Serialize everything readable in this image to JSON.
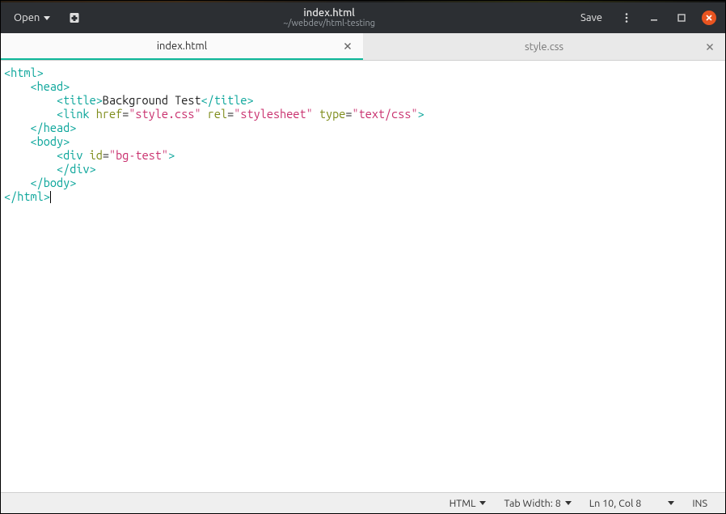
{
  "header": {
    "open_label": "Open",
    "save_label": "Save",
    "title": "index.html",
    "subtitle": "~/webdev/html-testing"
  },
  "tabs": [
    {
      "label": "index.html",
      "active": true
    },
    {
      "label": "style.css",
      "active": false
    }
  ],
  "editor": {
    "lines": [
      [
        {
          "cls": "tok-punct",
          "t": "<"
        },
        {
          "cls": "tok-tag",
          "t": "html"
        },
        {
          "cls": "tok-punct",
          "t": ">"
        }
      ],
      [
        {
          "cls": "tok-text",
          "t": "    "
        },
        {
          "cls": "tok-punct",
          "t": "<"
        },
        {
          "cls": "tok-tag",
          "t": "head"
        },
        {
          "cls": "tok-punct",
          "t": ">"
        }
      ],
      [
        {
          "cls": "tok-text",
          "t": "        "
        },
        {
          "cls": "tok-punct",
          "t": "<"
        },
        {
          "cls": "tok-tag",
          "t": "title"
        },
        {
          "cls": "tok-punct",
          "t": ">"
        },
        {
          "cls": "tok-text",
          "t": "Background Test"
        },
        {
          "cls": "tok-punct",
          "t": "</"
        },
        {
          "cls": "tok-tag",
          "t": "title"
        },
        {
          "cls": "tok-punct",
          "t": ">"
        }
      ],
      [
        {
          "cls": "tok-text",
          "t": "        "
        },
        {
          "cls": "tok-punct",
          "t": "<"
        },
        {
          "cls": "tok-tag",
          "t": "link"
        },
        {
          "cls": "tok-text",
          "t": " "
        },
        {
          "cls": "tok-attr",
          "t": "href"
        },
        {
          "cls": "tok-text",
          "t": "="
        },
        {
          "cls": "tok-str",
          "t": "\"style.css\""
        },
        {
          "cls": "tok-text",
          "t": " "
        },
        {
          "cls": "tok-attr",
          "t": "rel"
        },
        {
          "cls": "tok-text",
          "t": "="
        },
        {
          "cls": "tok-str",
          "t": "\"stylesheet\""
        },
        {
          "cls": "tok-text",
          "t": " "
        },
        {
          "cls": "tok-attr",
          "t": "type"
        },
        {
          "cls": "tok-text",
          "t": "="
        },
        {
          "cls": "tok-str",
          "t": "\"text/css\""
        },
        {
          "cls": "tok-punct",
          "t": ">"
        }
      ],
      [
        {
          "cls": "tok-text",
          "t": "    "
        },
        {
          "cls": "tok-punct",
          "t": "</"
        },
        {
          "cls": "tok-tag",
          "t": "head"
        },
        {
          "cls": "tok-punct",
          "t": ">"
        }
      ],
      [
        {
          "cls": "tok-text",
          "t": "    "
        },
        {
          "cls": "tok-punct",
          "t": "<"
        },
        {
          "cls": "tok-tag",
          "t": "body"
        },
        {
          "cls": "tok-punct",
          "t": ">"
        }
      ],
      [
        {
          "cls": "tok-text",
          "t": "        "
        },
        {
          "cls": "tok-punct",
          "t": "<"
        },
        {
          "cls": "tok-tag",
          "t": "div"
        },
        {
          "cls": "tok-text",
          "t": " "
        },
        {
          "cls": "tok-attr",
          "t": "id"
        },
        {
          "cls": "tok-text",
          "t": "="
        },
        {
          "cls": "tok-str",
          "t": "\"bg-test\""
        },
        {
          "cls": "tok-punct",
          "t": ">"
        }
      ],
      [
        {
          "cls": "tok-text",
          "t": "        "
        },
        {
          "cls": "tok-punct",
          "t": "</"
        },
        {
          "cls": "tok-tag",
          "t": "div"
        },
        {
          "cls": "tok-punct",
          "t": ">"
        }
      ],
      [
        {
          "cls": "tok-text",
          "t": "    "
        },
        {
          "cls": "tok-punct",
          "t": "</"
        },
        {
          "cls": "tok-tag",
          "t": "body"
        },
        {
          "cls": "tok-punct",
          "t": ">"
        }
      ],
      [
        {
          "cls": "tok-punct",
          "t": "</"
        },
        {
          "cls": "tok-tag",
          "t": "html"
        },
        {
          "cls": "tok-punct",
          "t": ">"
        },
        {
          "cls": "cursor",
          "t": ""
        }
      ]
    ]
  },
  "statusbar": {
    "language": "HTML",
    "tab_width": "Tab Width: 8",
    "position": "Ln 10, Col 8",
    "insert_mode": "INS"
  }
}
